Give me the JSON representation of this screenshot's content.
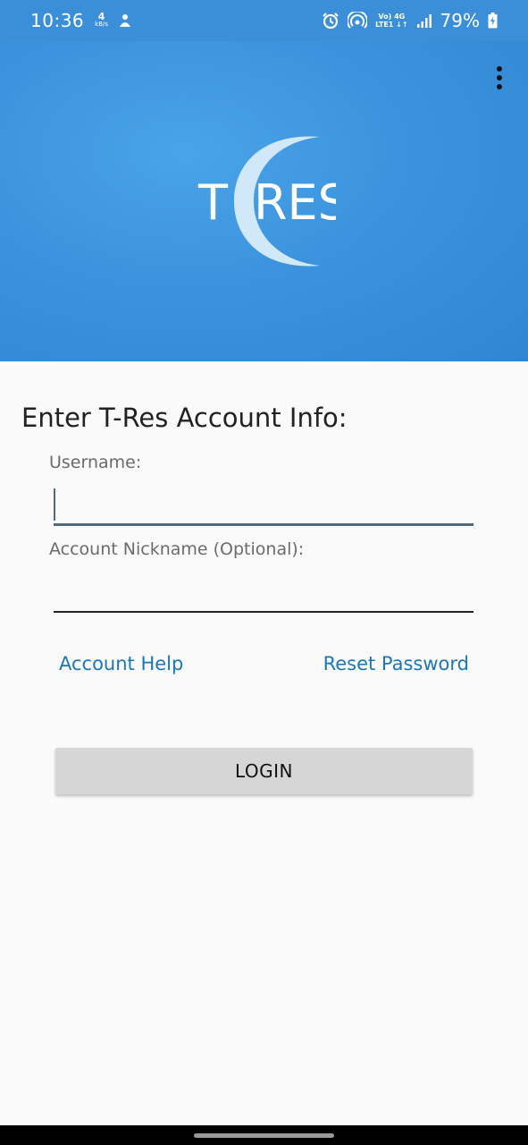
{
  "status_bar": {
    "time": "10:36",
    "data_rate_value": "4",
    "data_rate_unit": "kB/s",
    "network_line1": "Vo) 4G",
    "network_line2": "LTE1 ↓↑",
    "battery": "79%",
    "colors": {
      "background": "#3a8fd8",
      "text": "#ffffff"
    },
    "icons": [
      "notification-icon",
      "alarm-icon",
      "hotspot-icon",
      "signal-icon",
      "battery-charging-icon"
    ]
  },
  "header": {
    "logo_text_left": "T",
    "logo_text_right": "RES",
    "menu_icon": "more-vert-icon",
    "colors": {
      "background": "#3b93dd"
    }
  },
  "form": {
    "title": "Enter T-Res Account Info:",
    "username_label": "Username:",
    "username_value": "",
    "nickname_label": "Account Nickname (Optional):",
    "nickname_value": ""
  },
  "links": {
    "account_help": "Account Help",
    "reset_password": "Reset Password",
    "color": "#1a77b8"
  },
  "login_button": {
    "label": "LOGIN"
  }
}
